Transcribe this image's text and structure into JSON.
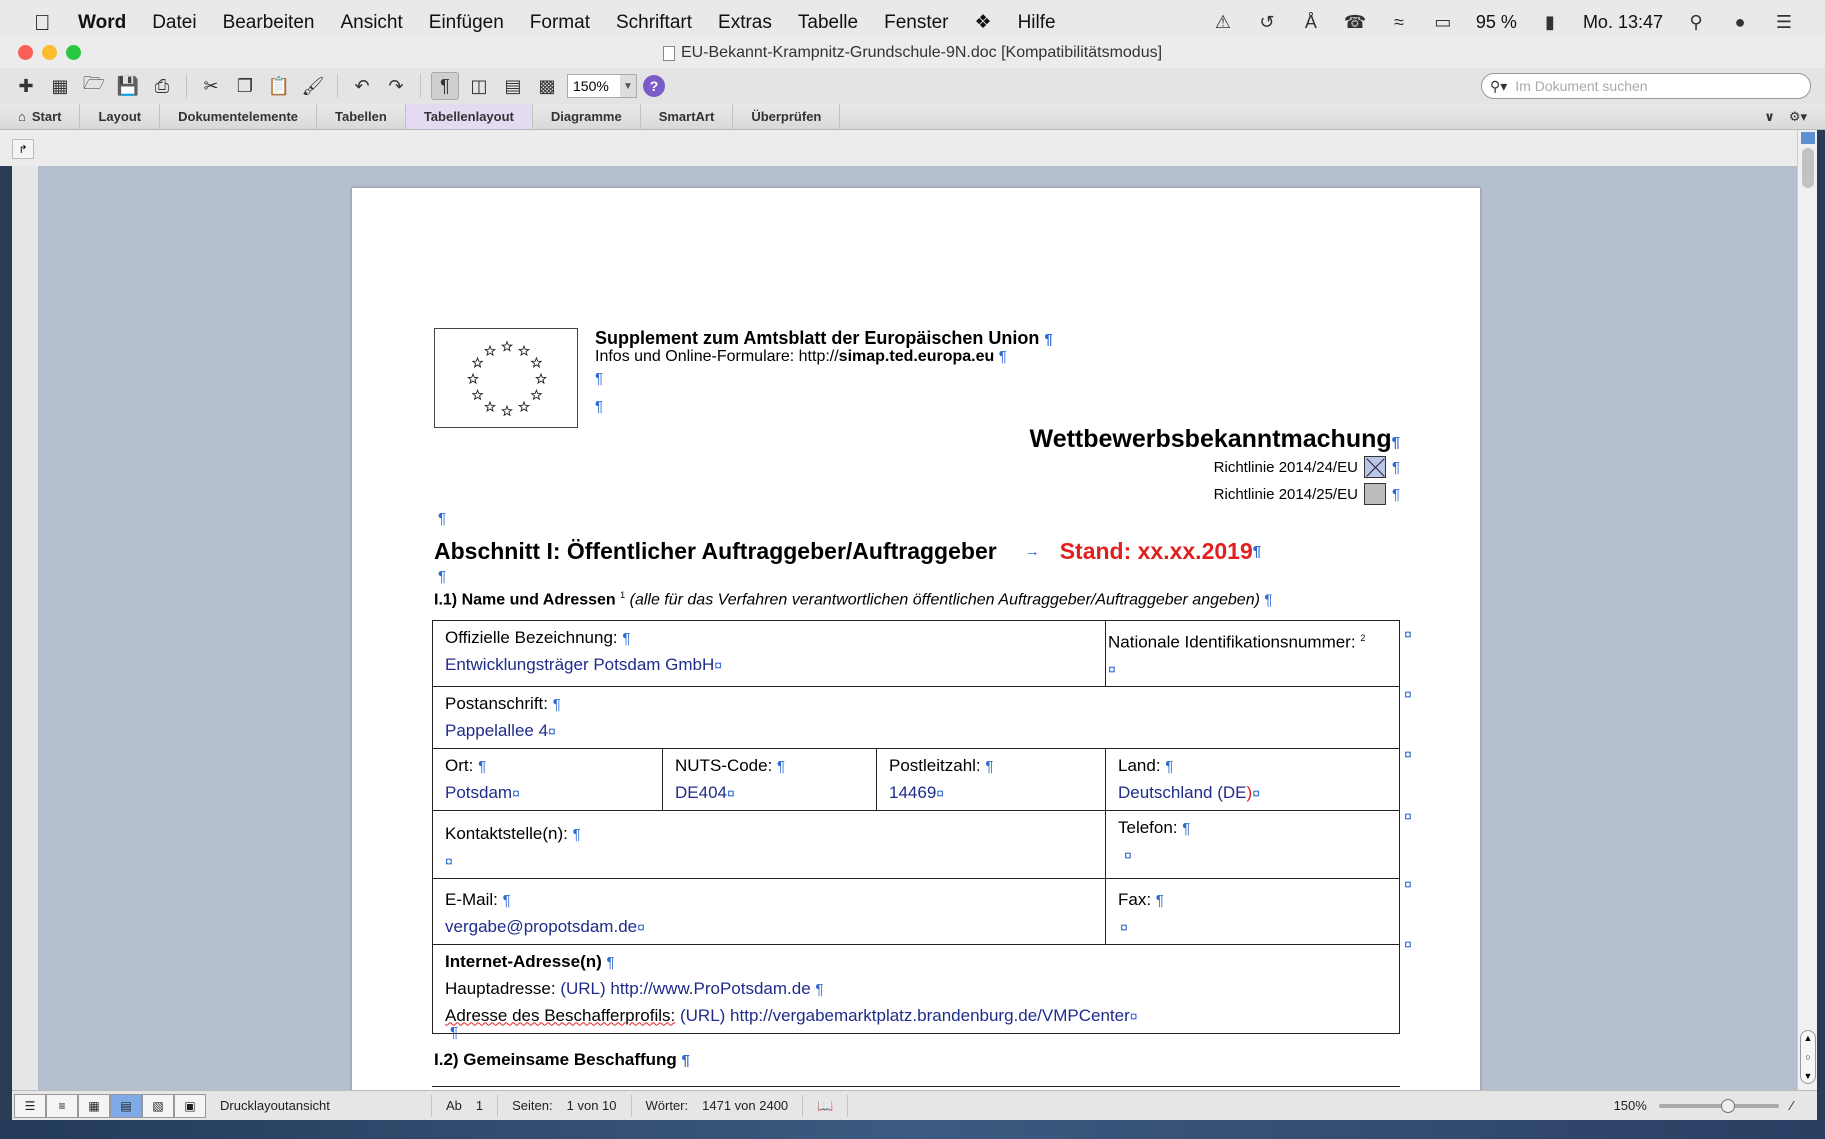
{
  "menubar": {
    "app": "Word",
    "items": [
      "Datei",
      "Bearbeiten",
      "Ansicht",
      "Einfügen",
      "Format",
      "Schriftart",
      "Extras",
      "Tabelle",
      "Fenster",
      "Hilfe"
    ],
    "battery": "95 %",
    "clock": "Mo. 13:47"
  },
  "window": {
    "title": "EU-Bekannt-Krampnitz-Grundschule-9N.doc [Kompatibilitätsmodus]"
  },
  "toolbar": {
    "zoom": "150%",
    "help_label": "?",
    "search_placeholder": "Im Dokument suchen"
  },
  "ribbon": {
    "tabs": [
      "Start",
      "Layout",
      "Dokumentelemente",
      "Tabellen",
      "Tabellenlayout",
      "Diagramme",
      "SmartArt",
      "Überprüfen"
    ],
    "active_tab": "Tabellenlayout"
  },
  "document": {
    "supplement_title": "Supplement zum Amtsblatt der Europäischen Union",
    "infos_prefix": "Infos und Online-Formulare: http://",
    "infos_domain": "simap.ted.europa.eu",
    "notice_title": "Wettbewerbsbekanntmachung",
    "directive_1": "Richtlinie 2014/24/EU",
    "directive_2": "Richtlinie 2014/25/EU",
    "section_title": "Abschnitt I: Öffentlicher Auftraggeber/Auftraggeber",
    "stand": "Stand: xx.xx.2019",
    "i1_title": "I.1) Name und Adressen",
    "i1_sup": "1",
    "i1_note": "(alle für das Verfahren verantwortlichen öffentlichen Auftraggeber/Auftraggeber angeben)",
    "table": {
      "official_name_label": "Offizielle Bezeichnung:",
      "official_name_value": "Entwicklungsträger Potsdam GmbH",
      "national_id_label": "Nationale Identifikationsnummer:",
      "national_id_sup": "2",
      "postal_label": "Postanschrift:",
      "postal_value": "Pappelallee 4",
      "city_label": "Ort:",
      "city_value": "Potsdam",
      "nuts_label": "NUTS-Code:",
      "nuts_value": "DE404",
      "zip_label": "Postleitzahl:",
      "zip_value": "14469",
      "country_label": "Land:",
      "country_value_main": "Deutschland (DE",
      "country_value_close": ")",
      "contact_label": "Kontaktstelle(n):",
      "phone_label": "Telefon:",
      "email_label": "E-Mail:",
      "email_value": "vergabe@propotsdam.de",
      "fax_label": "Fax:",
      "internet_label": "Internet-Adresse(n)",
      "main_address_label": "Hauptadresse:",
      "main_address_value": "(URL) http://www.ProPotsdam.de",
      "buyer_profile_label": "Adresse des Beschafferprofils:",
      "buyer_profile_value": "(URL) http://vergabemarktplatz.brandenburg.de/VMPCenter"
    },
    "i2_title": "I.2) Gemeinsame Beschaffung"
  },
  "statusbar": {
    "view_name": "Drucklayoutansicht",
    "ab_label": "Ab",
    "ab_value": "1",
    "pages_label": "Seiten:",
    "pages_value": "1 von 10",
    "words_label": "Wörter:",
    "words_value": "1471 von 2400",
    "zoom": "150%"
  },
  "colors": {
    "pilcrow": "#2d6ad2",
    "field_value": "#1f2c8a",
    "stand_red": "#e21f1f",
    "active_tab": "#e4dbf3"
  }
}
